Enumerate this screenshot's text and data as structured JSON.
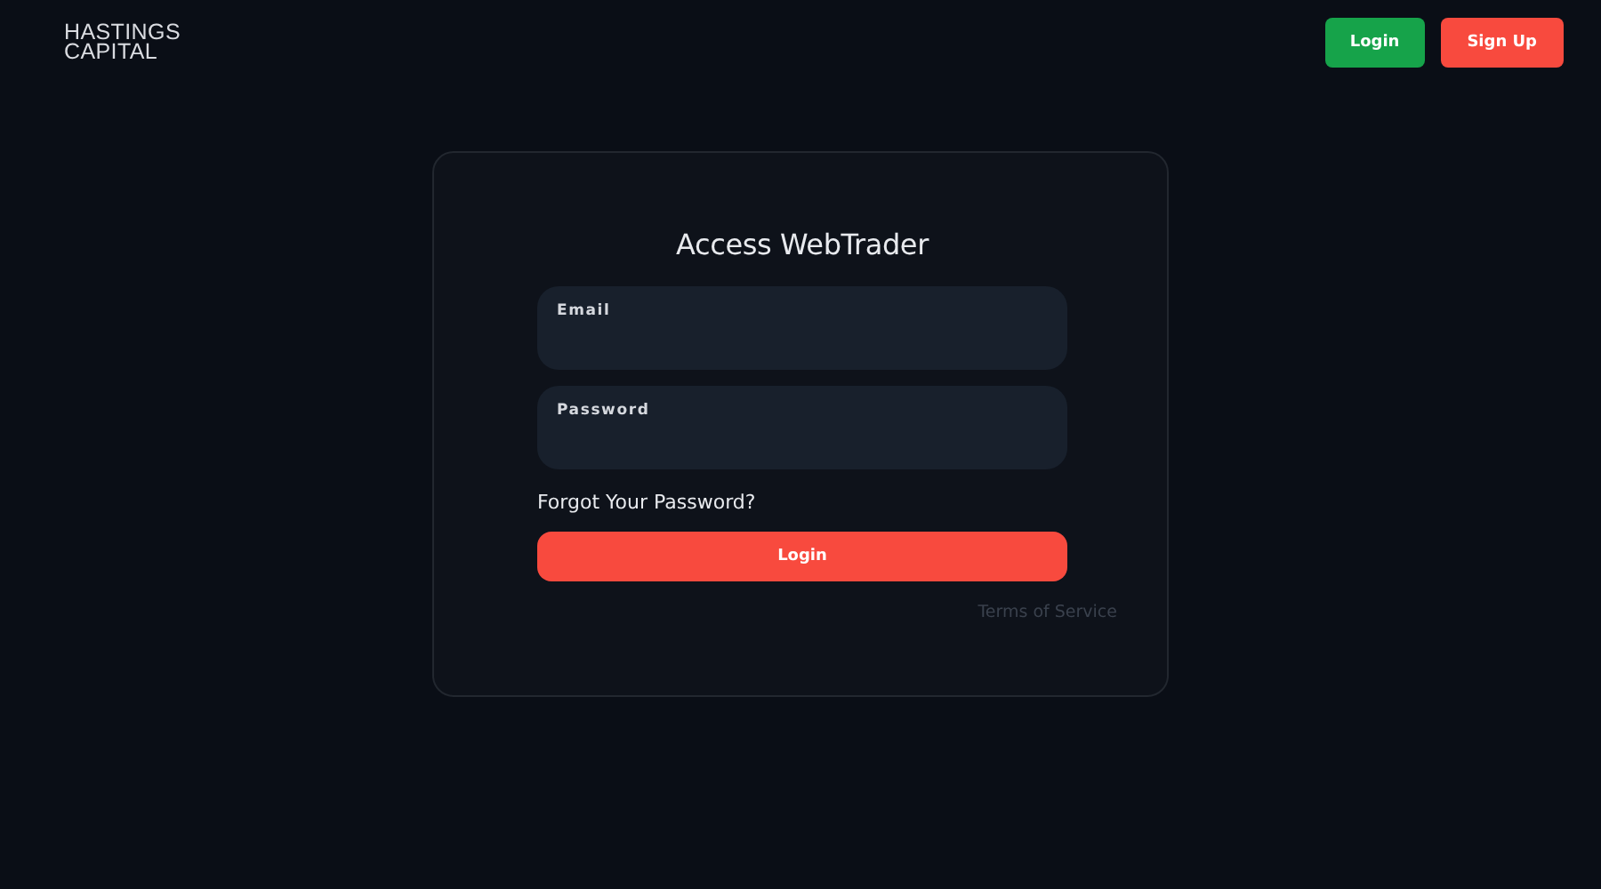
{
  "logo": {
    "lines": [
      "HASTINGS",
      "CAPITAL"
    ]
  },
  "header_buttons": [
    {
      "label": "Login",
      "kind": "success"
    },
    {
      "label": "Sign Up",
      "kind": "danger"
    }
  ],
  "login_card": {
    "title": "Access WebTrader",
    "fields": [
      {
        "label": "Email"
      },
      {
        "label": "Password"
      }
    ],
    "forgot_link": "Forgot Your Password?",
    "submit_button": "Login",
    "terms_link": "Terms of Service"
  }
}
